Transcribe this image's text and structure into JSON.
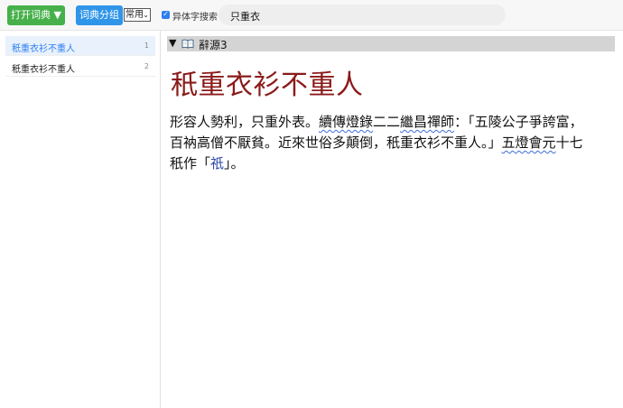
{
  "toolbar": {
    "open_dict_label": "打开词典 ▼",
    "dict_group_label": "词典分组",
    "group_select_value": "常用",
    "variant_search_label": "异体字搜索",
    "variant_search_checked": true,
    "search_value": "只重衣"
  },
  "sidebar": {
    "items": [
      {
        "label": "秖重衣衫不重人",
        "count": "1",
        "active": true
      },
      {
        "label": "秖重衣衫不重人",
        "count": "2",
        "active": false
      }
    ]
  },
  "entry": {
    "dictionary_name": "辭源3",
    "headword": "秖重衣衫不重人",
    "definition": {
      "line1_a": "形容人勢利，只重外表。",
      "line1_source": "續傳燈錄",
      "line1_b": "二二",
      "line1_author": "繼昌禪師",
      "line1_c": "：「五陵公子爭誇富，",
      "line2_a": "百衲高僧不厭貧。近來世俗多顛倒，秖重衣衫不重人。」",
      "line2_source": "五燈會元",
      "line2_b": "十七",
      "line3_a": "秖作「",
      "line3_link": "祇",
      "line3_b": "」。"
    }
  },
  "colors": {
    "open_button": "#46b04a",
    "group_button": "#2f95e9",
    "headword": "#8b1a1a",
    "link": "#2b47a8",
    "active_item_text": "#2f7ff0"
  },
  "icons": {
    "collapse": "triangle-down-icon",
    "dictionary": "book-icon",
    "checkbox": "checkbox-checked-icon"
  }
}
